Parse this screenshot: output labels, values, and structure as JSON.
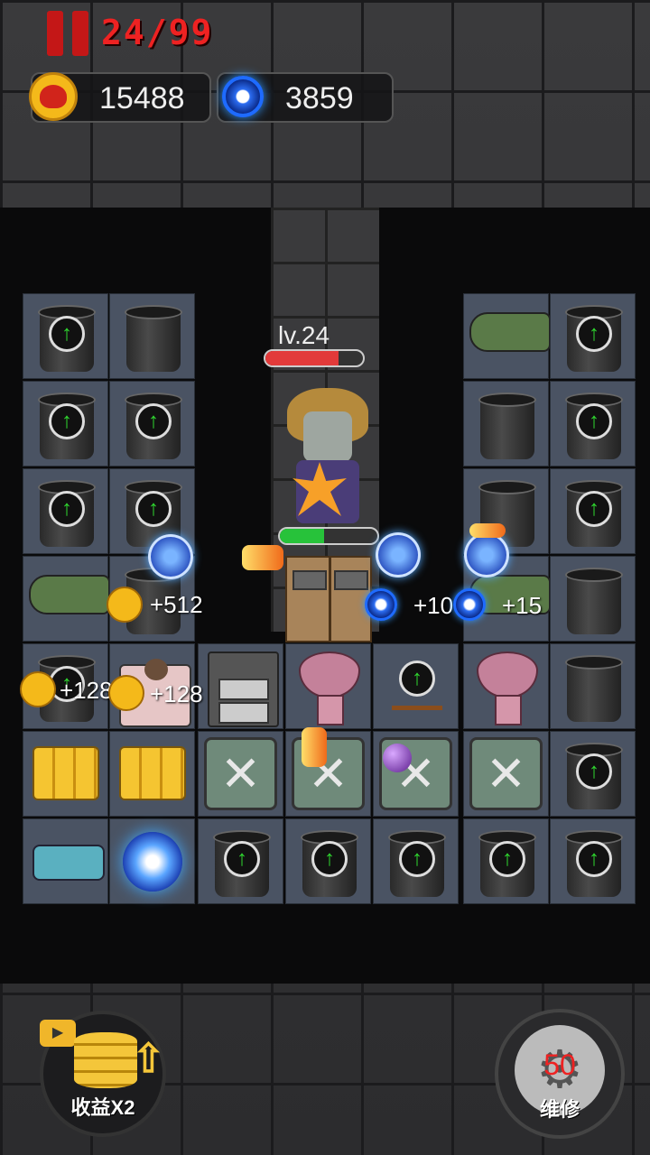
{
  "hud": {
    "wave": "24/99",
    "coins": "15488",
    "gems": "3859"
  },
  "enemy": {
    "level": "lv.24",
    "hp_fraction": 0.75,
    "shield_fraction": 0.45
  },
  "floating": {
    "coin_gain_a": "+512",
    "coin_gain_b": "+128",
    "coin_gain_c": "+128",
    "gem_gain_a": "+10",
    "gem_gain_b": "+15"
  },
  "buttons": {
    "double_income": "收益X2",
    "repair_cost": "50",
    "repair": "维修"
  },
  "colors": {
    "wave_red": "#e22222",
    "hp_red": "#e23a3a",
    "shield_green": "#27c23a"
  }
}
